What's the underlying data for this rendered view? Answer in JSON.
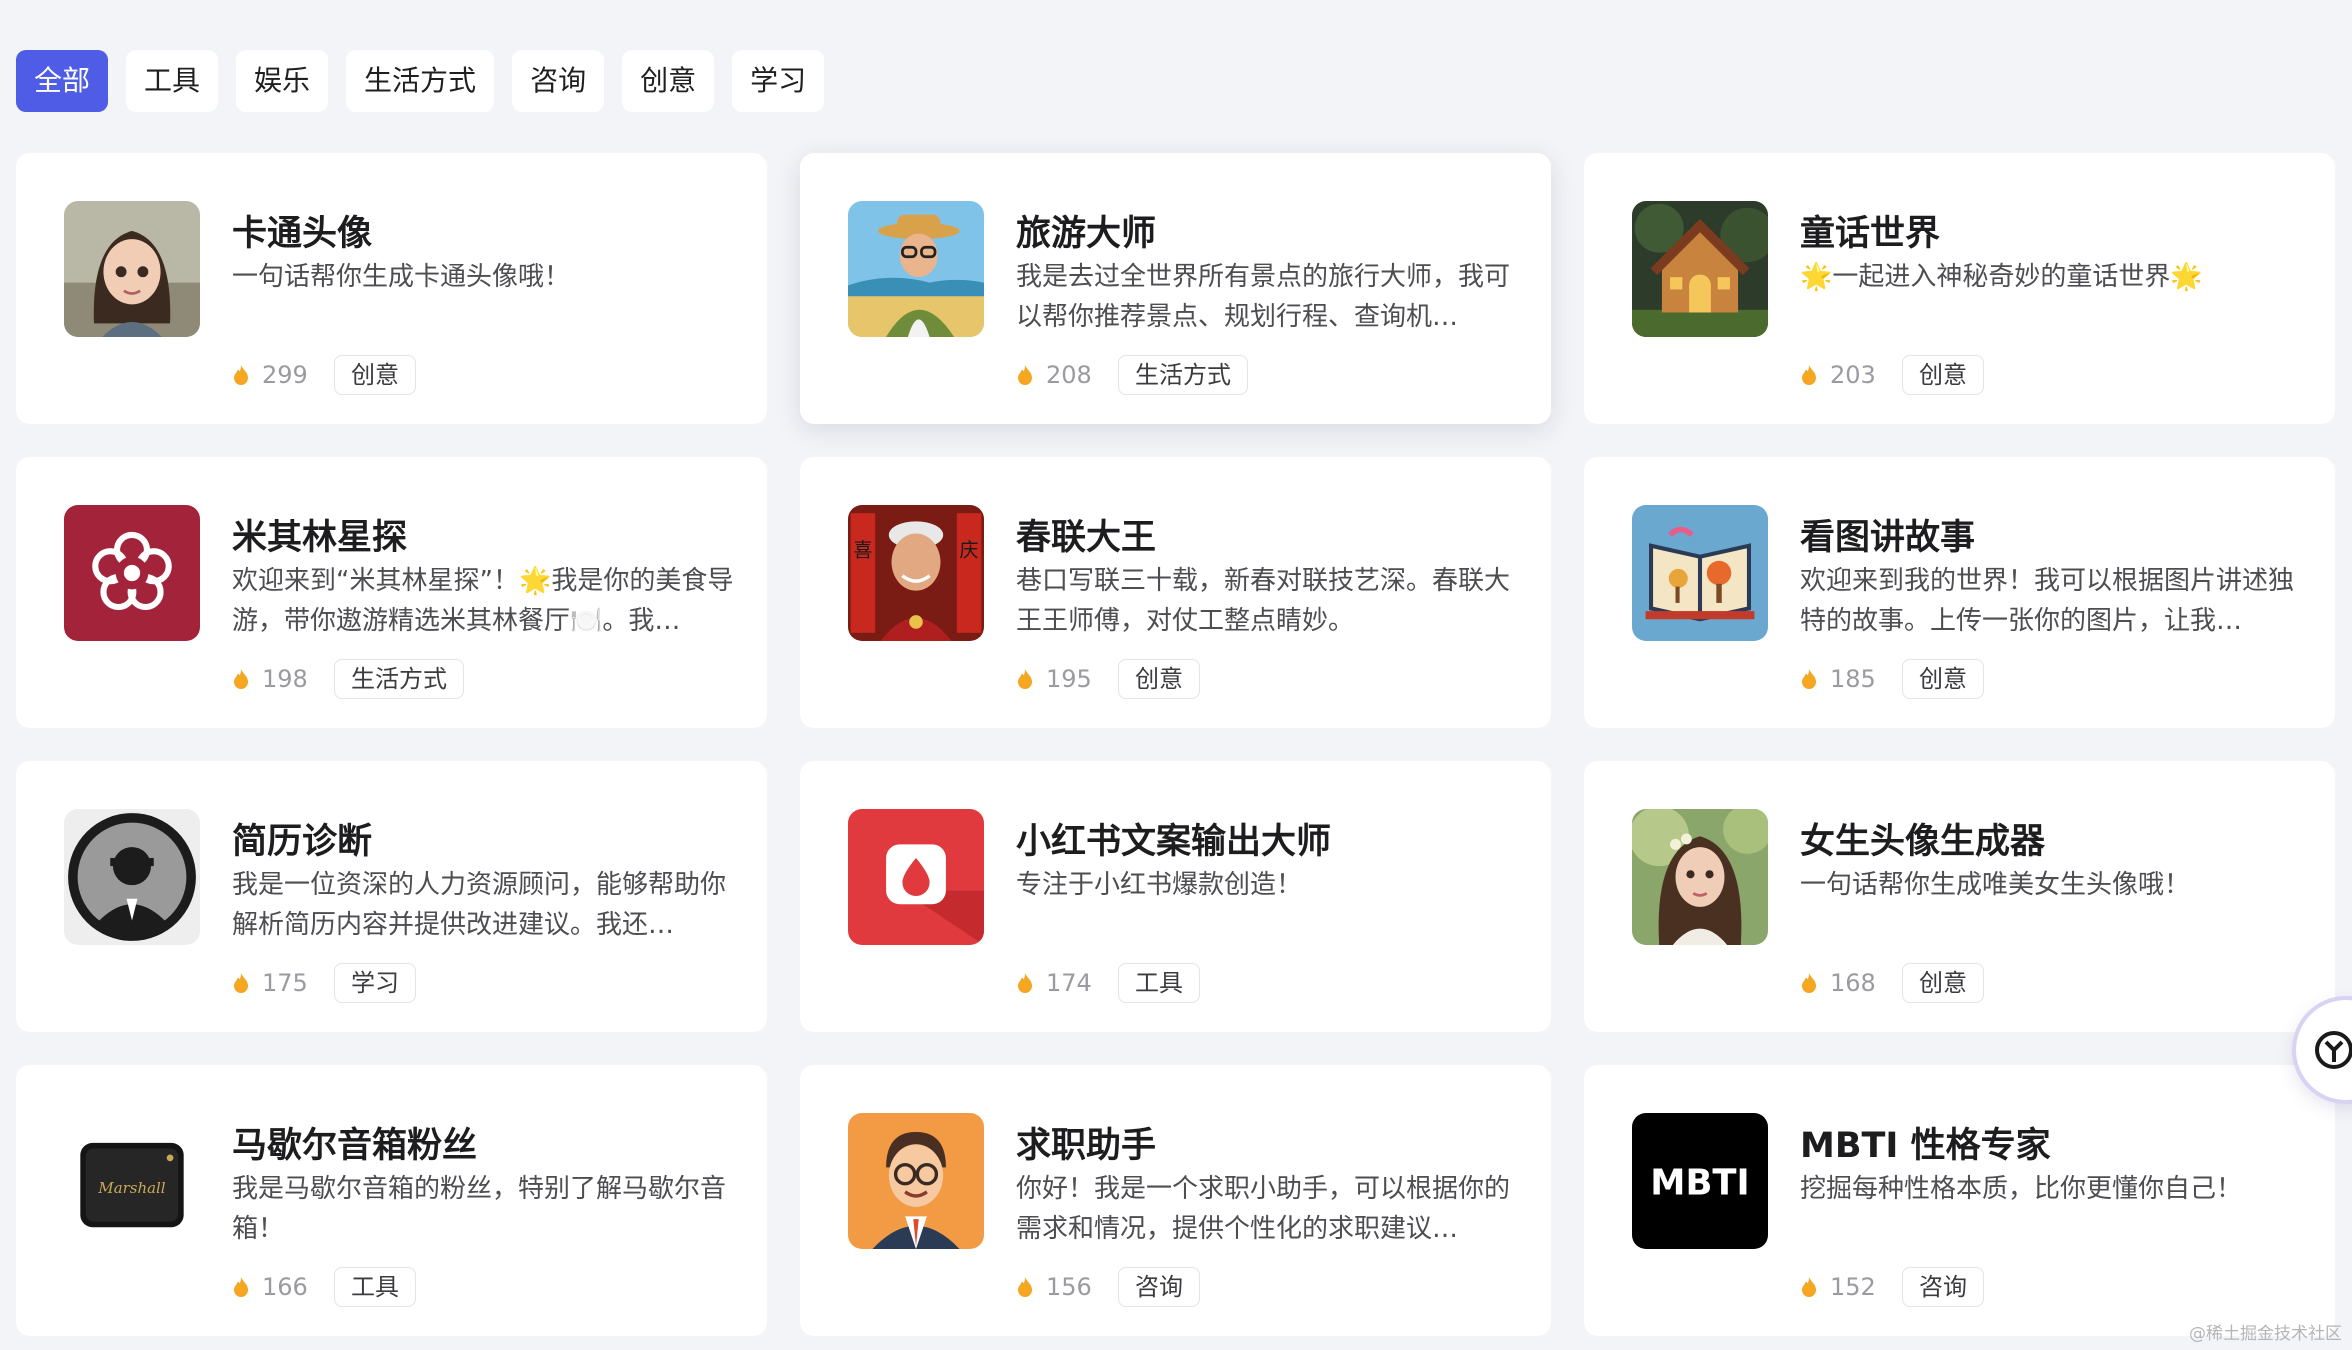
{
  "tabs": [
    "全部",
    "工具",
    "娱乐",
    "生活方式",
    "咨询",
    "创意",
    "学习"
  ],
  "active_tab": "全部",
  "cards": [
    {
      "title": "卡通头像",
      "desc": "一句话帮你生成卡通头像哦！",
      "count": "299",
      "tag": "创意"
    },
    {
      "title": "旅游大师",
      "desc": "我是去过全世界所有景点的旅行大师，我可以帮你推荐景点、规划行程、查询机…",
      "count": "208",
      "tag": "生活方式"
    },
    {
      "title": "童话世界",
      "desc": "🌟一起进入神秘奇妙的童话世界🌟",
      "count": "203",
      "tag": "创意"
    },
    {
      "title": "米其林星探",
      "desc": "欢迎来到“米其林星探”！🌟我是你的美食导游，带你遨游精选米其林餐厅🍽️。我…",
      "count": "198",
      "tag": "生活方式"
    },
    {
      "title": "春联大王",
      "desc": "巷口写联三十载，新春对联技艺深。春联大王王师傅，对仗工整点睛妙。",
      "count": "195",
      "tag": "创意"
    },
    {
      "title": "看图讲故事",
      "desc": "欢迎来到我的世界！我可以根据图片讲述独特的故事。上传一张你的图片，让我…",
      "count": "185",
      "tag": "创意"
    },
    {
      "title": "简历诊断",
      "desc": "我是一位资深的人力资源顾问，能够帮助你解析简历内容并提供改进建议。我还…",
      "count": "175",
      "tag": "学习"
    },
    {
      "title": "小红书文案输出大师",
      "desc": "专注于小红书爆款创造！",
      "count": "174",
      "tag": "工具"
    },
    {
      "title": "女生头像生成器",
      "desc": "一句话帮你生成唯美女生头像哦！",
      "count": "168",
      "tag": "创意"
    },
    {
      "title": "马歇尔音箱粉丝",
      "desc": "我是马歇尔音箱的粉丝，特别了解马歇尔音箱！",
      "count": "166",
      "tag": "工具"
    },
    {
      "title": "求职助手",
      "desc": "你好！我是一个求职小助手，可以根据你的需求和情况，提供个性化的求职建议…",
      "count": "156",
      "tag": "咨询"
    },
    {
      "title": "MBTI 性格专家",
      "desc": "挖掘每种性格本质，比你更懂你自己！",
      "count": "152",
      "tag": "咨询"
    }
  ],
  "avatar_texts": {
    "speaker": "Marshall",
    "mbti": "MBTI",
    "couplet_left": "喜",
    "couplet_right": "庆"
  },
  "watermark": "@稀土掘金技术社区",
  "colors": {
    "accent": "#4e5ce6",
    "fire": "#f5a623"
  }
}
